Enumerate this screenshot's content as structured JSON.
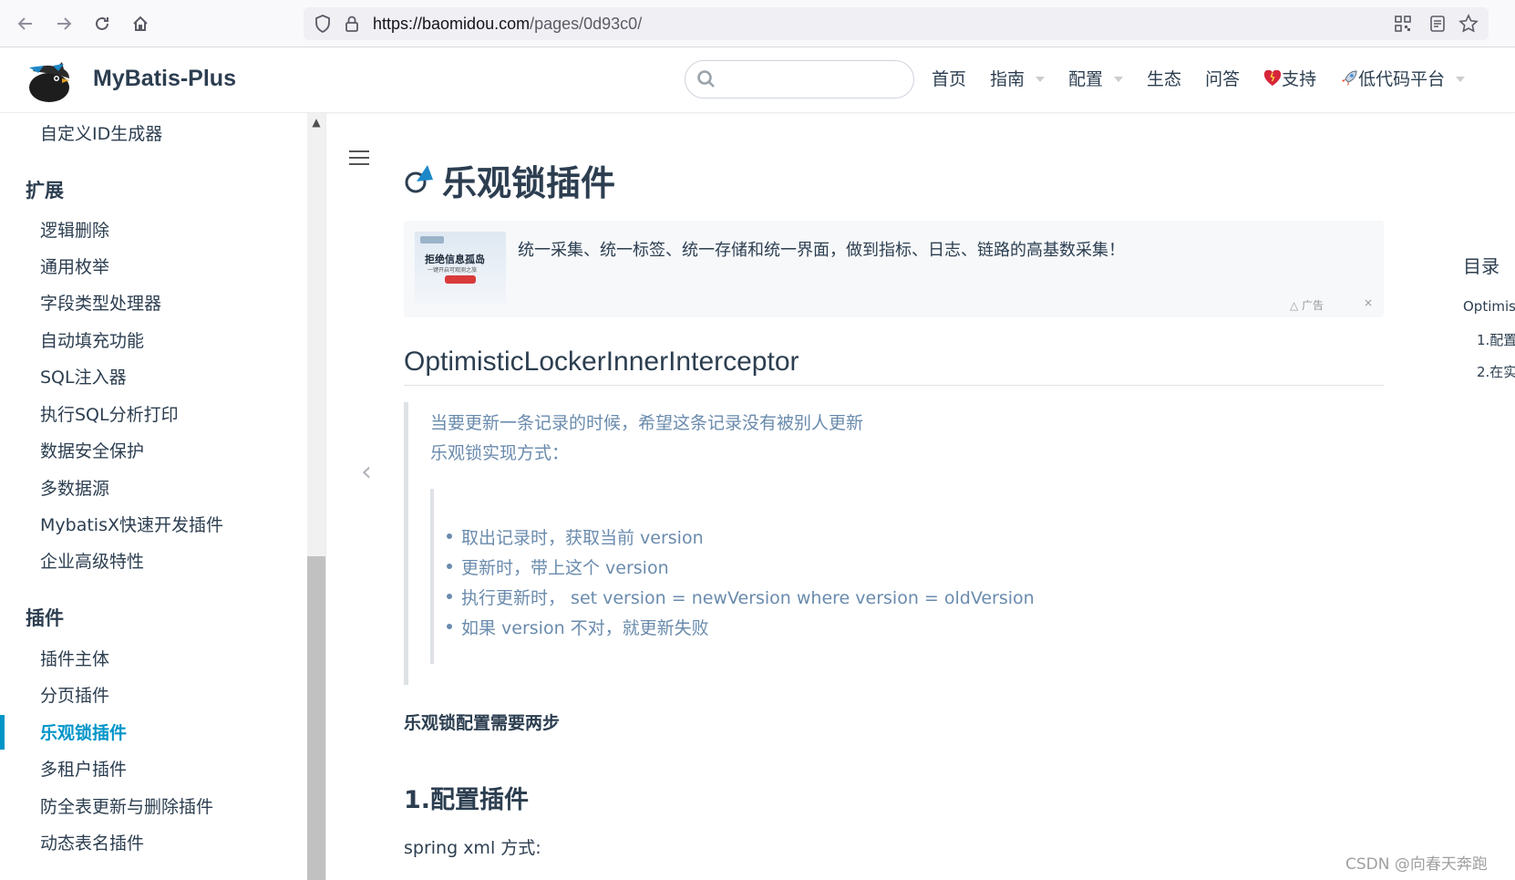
{
  "browser": {
    "url_host": "https://baomidou.com",
    "url_path": "/pages/0d93c0/"
  },
  "header": {
    "site_name": "MyBatis-Plus",
    "search_placeholder": "",
    "nav": [
      {
        "label": "首页"
      },
      {
        "label": "指南",
        "dropdown": true
      },
      {
        "label": "配置",
        "dropdown": true
      },
      {
        "label": "生态"
      },
      {
        "label": "问答"
      },
      {
        "label": "支持",
        "icon": "heart-icon"
      },
      {
        "label": "低代码平台",
        "icon": "rocket-icon",
        "dropdown": true
      }
    ]
  },
  "sidebar": {
    "top_item": "自定义ID生成器",
    "groups": [
      {
        "title": "扩展",
        "items": [
          "逻辑删除",
          "通用枚举",
          "字段类型处理器",
          "自动填充功能",
          "SQL注入器",
          "执行SQL分析打印",
          "数据安全保护",
          "多数据源",
          "MybatisX快速开发插件",
          "企业高级特性"
        ]
      },
      {
        "title": "插件",
        "items": [
          "插件主体",
          "分页插件",
          "乐观锁插件",
          "多租户插件",
          "防全表更新与删除插件",
          "动态表名插件"
        ],
        "active": "乐观锁插件"
      }
    ]
  },
  "main": {
    "title": "乐观锁插件",
    "ad": {
      "image_line1": "拒绝信息孤岛",
      "image_line2": "一键开启可观测之旅",
      "text": "统一采集、统一标签、统一存储和统一界面，做到指标、日志、链路的高基数采集！",
      "label": "广告",
      "close": "×"
    },
    "section_heading": "OptimisticLockerInnerInterceptor",
    "quote_line1": "当要更新一条记录的时候，希望这条记录没有被别人更新",
    "quote_line2": "乐观锁实现方式：",
    "list": [
      "取出记录时，获取当前 version",
      "更新时，带上这个 version",
      "执行更新时， set version = newVersion where version = oldVersion",
      "如果 version 不对，就更新失败"
    ],
    "strong_line": "乐观锁配置需要两步",
    "h3": "1.配置插件",
    "para": "spring xml 方式:"
  },
  "toc": {
    "title": "目录",
    "items": [
      "Optimis",
      "1.配置",
      "2.在实"
    ]
  },
  "watermark": "CSDN @向春天奔跑",
  "colors": {
    "accent": "#0095c8",
    "text": "#2c3e50",
    "quote_text": "#6a8bad"
  }
}
